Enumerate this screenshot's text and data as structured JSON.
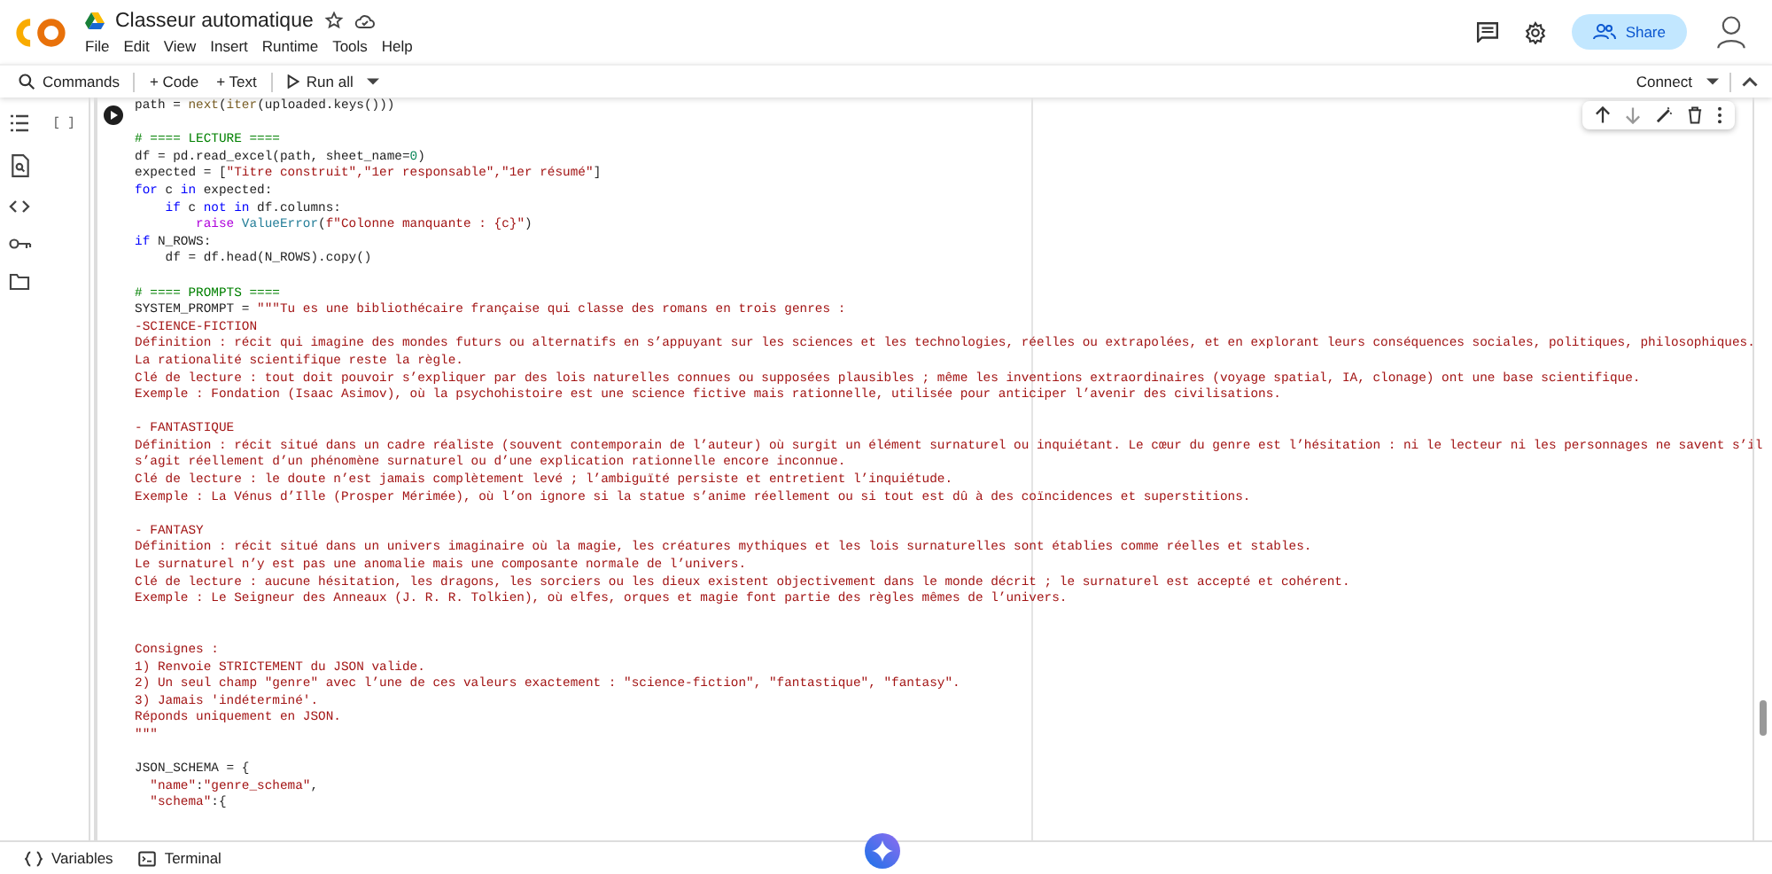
{
  "header": {
    "title": "Classeur automatique",
    "menu": [
      "File",
      "Edit",
      "View",
      "Insert",
      "Runtime",
      "Tools",
      "Help"
    ],
    "share_label": "Share"
  },
  "toolbar": {
    "commands": "Commands",
    "add_code": "+ Code",
    "add_text": "+ Text",
    "run_all": "Run all",
    "connect": "Connect"
  },
  "cell": {
    "bracket": "[ ]",
    "lines": [
      {
        "kind": "code",
        "tokens": [
          {
            "text": "path = ",
            "kind": "plain"
          },
          {
            "text": "next",
            "kind": "func"
          },
          {
            "text": "(",
            "kind": "plain"
          },
          {
            "text": "iter",
            "kind": "func"
          },
          {
            "text": "(uploaded.keys()))",
            "kind": "plain"
          }
        ]
      },
      {
        "kind": "blank"
      },
      {
        "kind": "code",
        "tokens": [
          {
            "text": "# ==== LECTURE ====",
            "kind": "comment"
          }
        ]
      },
      {
        "kind": "code",
        "tokens": [
          {
            "text": "df = pd.read_excel(path, sheet_name=",
            "kind": "plain"
          },
          {
            "text": "0",
            "kind": "number"
          },
          {
            "text": ")",
            "kind": "plain"
          }
        ]
      },
      {
        "kind": "code",
        "tokens": [
          {
            "text": "expected = [",
            "kind": "plain"
          },
          {
            "text": "\"Titre construit\",\"1er responsable\",\"1er résumé\"",
            "kind": "string"
          },
          {
            "text": "]",
            "kind": "plain"
          }
        ]
      },
      {
        "kind": "code",
        "tokens": [
          {
            "text": "for",
            "kind": "keyword"
          },
          {
            "text": " c ",
            "kind": "plain"
          },
          {
            "text": "in",
            "kind": "keyword"
          },
          {
            "text": " expected:",
            "kind": "plain"
          }
        ]
      },
      {
        "kind": "code",
        "tokens": [
          {
            "text": "    if",
            "kind": "keyword"
          },
          {
            "text": " c ",
            "kind": "plain"
          },
          {
            "text": "not in",
            "kind": "keyword"
          },
          {
            "text": " df.columns:",
            "kind": "plain"
          }
        ]
      },
      {
        "kind": "code",
        "tokens": [
          {
            "text": "        raise ",
            "kind": "control"
          },
          {
            "text": "ValueError",
            "kind": "class"
          },
          {
            "text": "(",
            "kind": "plain"
          },
          {
            "text": "f\"Colonne manquante : {c}\"",
            "kind": "string"
          },
          {
            "text": ")",
            "kind": "plain"
          }
        ]
      },
      {
        "kind": "code",
        "tokens": [
          {
            "text": "if",
            "kind": "keyword"
          },
          {
            "text": " N_ROWS:",
            "kind": "plain"
          }
        ]
      },
      {
        "kind": "code",
        "tokens": [
          {
            "text": "    df = df.head(N_ROWS).copy()",
            "kind": "plain"
          }
        ]
      },
      {
        "kind": "blank"
      },
      {
        "kind": "code",
        "tokens": [
          {
            "text": "# ==== PROMPTS ====",
            "kind": "comment"
          }
        ]
      },
      {
        "kind": "code",
        "tokens": [
          {
            "text": "SYSTEM_PROMPT = ",
            "kind": "plain"
          },
          {
            "text": "\"\"\"Tu es une bibliothécaire française qui classe des romans en trois genres :",
            "kind": "string"
          }
        ]
      },
      {
        "kind": "code",
        "tokens": [
          {
            "text": "-SCIENCE-FICTION",
            "kind": "string"
          }
        ]
      },
      {
        "kind": "code",
        "tokens": [
          {
            "text": "Définition : récit qui imagine des mondes futurs ou alternatifs en s’appuyant sur les sciences et les technologies, réelles ou extrapolées, et en explorant leurs conséquences sociales, politiques, philosophiques.",
            "kind": "string"
          }
        ]
      },
      {
        "kind": "code",
        "tokens": [
          {
            "text": "La rationalité scientifique reste la règle.",
            "kind": "string"
          }
        ]
      },
      {
        "kind": "code",
        "tokens": [
          {
            "text": "Clé de lecture : tout doit pouvoir s’expliquer par des lois naturelles connues ou supposées plausibles ; même les inventions extraordinaires (voyage spatial, IA, clonage) ont une base scientifique.",
            "kind": "string"
          }
        ]
      },
      {
        "kind": "code",
        "tokens": [
          {
            "text": "Exemple : Fondation (Isaac Asimov), où la psychohistoire est une science fictive mais rationnelle, utilisée pour anticiper l’avenir des civilisations.",
            "kind": "string"
          }
        ]
      },
      {
        "kind": "blank"
      },
      {
        "kind": "code",
        "tokens": [
          {
            "text": "- FANTASTIQUE",
            "kind": "string"
          }
        ]
      },
      {
        "kind": "code",
        "tokens": [
          {
            "text": "Définition : récit situé dans un cadre réaliste (souvent contemporain de l’auteur) où surgit un élément surnaturel ou inquiétant. Le cœur du genre est l’hésitation : ni le lecteur ni les personnages ne savent s’il",
            "kind": "string"
          }
        ]
      },
      {
        "kind": "code",
        "tokens": [
          {
            "text": "s’agit réellement d’un phénomène surnaturel ou d’une explication rationnelle encore inconnue.",
            "kind": "string"
          }
        ]
      },
      {
        "kind": "code",
        "tokens": [
          {
            "text": "Clé de lecture : le doute n’est jamais complètement levé ; l’ambiguïté persiste et entretient l’inquiétude.",
            "kind": "string"
          }
        ]
      },
      {
        "kind": "code",
        "tokens": [
          {
            "text": "Exemple : La Vénus d’Ille (Prosper Mérimée), où l’on ignore si la statue s’anime réellement ou si tout est dû à des coïncidences et superstitions.",
            "kind": "string"
          }
        ]
      },
      {
        "kind": "blank"
      },
      {
        "kind": "code",
        "tokens": [
          {
            "text": "- FANTASY",
            "kind": "string"
          }
        ]
      },
      {
        "kind": "code",
        "tokens": [
          {
            "text": "Définition : récit situé dans un univers imaginaire où la magie, les créatures mythiques et les lois surnaturelles sont établies comme réelles et stables.",
            "kind": "string"
          }
        ]
      },
      {
        "kind": "code",
        "tokens": [
          {
            "text": "Le surnaturel n’y est pas une anomalie mais une composante normale de l’univers.",
            "kind": "string"
          }
        ]
      },
      {
        "kind": "code",
        "tokens": [
          {
            "text": "Clé de lecture : aucune hésitation, les dragons, les sorciers ou les dieux existent objectivement dans le monde décrit ; le surnaturel est accepté et cohérent.",
            "kind": "string"
          }
        ]
      },
      {
        "kind": "code",
        "tokens": [
          {
            "text": "Exemple : Le Seigneur des Anneaux (J. R. R. Tolkien), où elfes, orques et magie font partie des règles mêmes de l’univers.",
            "kind": "string"
          }
        ]
      },
      {
        "kind": "blank"
      },
      {
        "kind": "blank"
      },
      {
        "kind": "code",
        "tokens": [
          {
            "text": "Consignes :",
            "kind": "string"
          }
        ]
      },
      {
        "kind": "code",
        "tokens": [
          {
            "text": "1) Renvoie STRICTEMENT du JSON valide.",
            "kind": "string"
          }
        ]
      },
      {
        "kind": "code",
        "tokens": [
          {
            "text": "2) Un seul champ \"genre\" avec l’une de ces valeurs exactement : \"science-fiction\", \"fantastique\", \"fantasy\".",
            "kind": "string"
          }
        ]
      },
      {
        "kind": "code",
        "tokens": [
          {
            "text": "3) Jamais 'indéterminé'.",
            "kind": "string"
          }
        ]
      },
      {
        "kind": "code",
        "tokens": [
          {
            "text": "Réponds uniquement en JSON.",
            "kind": "string"
          }
        ]
      },
      {
        "kind": "code",
        "tokens": [
          {
            "text": "\"\"\"",
            "kind": "string"
          }
        ]
      },
      {
        "kind": "blank"
      },
      {
        "kind": "code",
        "tokens": [
          {
            "text": "JSON_SCHEMA = {",
            "kind": "plain"
          }
        ]
      },
      {
        "kind": "code",
        "tokens": [
          {
            "text": "  \"name\"",
            "kind": "string"
          },
          {
            "text": ":",
            "kind": "plain"
          },
          {
            "text": "\"genre_schema\"",
            "kind": "string"
          },
          {
            "text": ",",
            "kind": "plain"
          }
        ]
      },
      {
        "kind": "code",
        "tokens": [
          {
            "text": "  \"schema\"",
            "kind": "string"
          },
          {
            "text": ":{",
            "kind": "plain"
          }
        ]
      }
    ]
  },
  "bottom_bar": {
    "variables": "Variables",
    "terminal": "Terminal"
  }
}
